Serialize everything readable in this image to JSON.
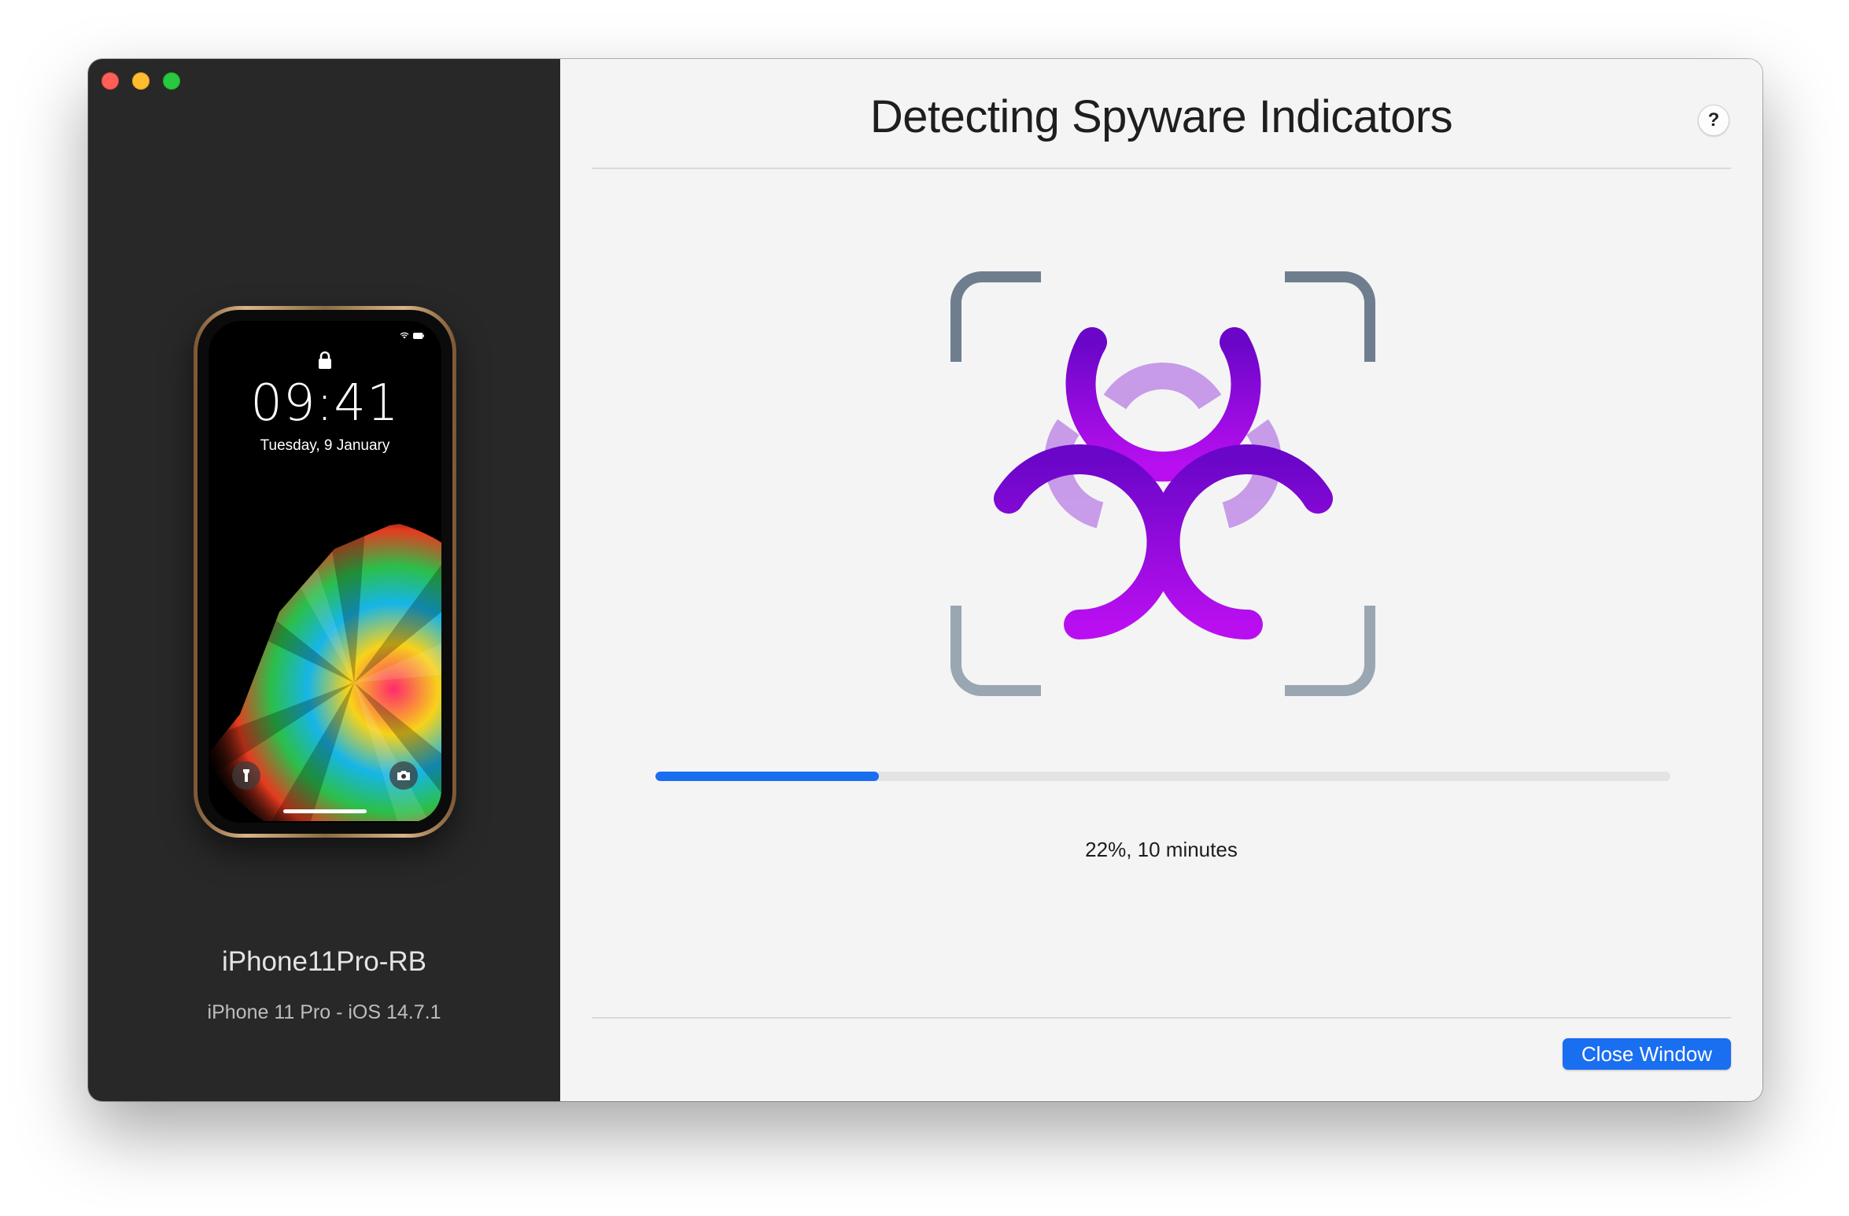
{
  "window": {
    "title": "Detecting Spyware Indicators",
    "help_label": "?"
  },
  "device": {
    "name": "iPhone11Pro-RB",
    "model": "iPhone 11 Pro - iOS 14.7.1",
    "lock_time": "09:41",
    "lock_date": "Tuesday, 9 January"
  },
  "scan": {
    "progress_percent": 22,
    "status_text": "22%, 10 minutes",
    "icon": "biohazard-icon"
  },
  "footer": {
    "close_label": "Close Window"
  },
  "colors": {
    "accent": "#1a6ef0",
    "sidebar": "#282828",
    "biohazard_dark": "#6a06c8",
    "biohazard_light": "#b90ff0"
  }
}
